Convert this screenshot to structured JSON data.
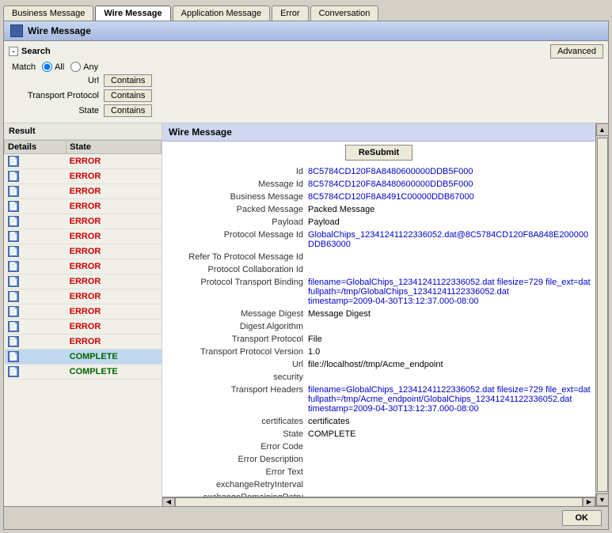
{
  "tabs": [
    {
      "id": "business-message",
      "label": "Business Message",
      "active": false
    },
    {
      "id": "wire-message",
      "label": "Wire Message",
      "active": true
    },
    {
      "id": "application-message",
      "label": "Application Message",
      "active": false
    },
    {
      "id": "error",
      "label": "Error",
      "active": false
    },
    {
      "id": "conversation",
      "label": "Conversation",
      "active": false
    }
  ],
  "title": "Wire Message",
  "search": {
    "header": "Search",
    "match_label": "Match",
    "match_all": "All",
    "match_any": "Any",
    "url_label": "Url",
    "url_value": "Contains",
    "transport_protocol_label": "Transport Protocol",
    "transport_protocol_value": "Contains",
    "state_label": "State",
    "state_value": "Contains",
    "advanced_label": "Advanced"
  },
  "result": {
    "title": "Result",
    "columns": [
      "Details",
      "State"
    ],
    "rows": [
      {
        "state": "ERROR",
        "selected": false
      },
      {
        "state": "ERROR",
        "selected": false
      },
      {
        "state": "ERROR",
        "selected": false
      },
      {
        "state": "ERROR",
        "selected": false
      },
      {
        "state": "ERROR",
        "selected": false
      },
      {
        "state": "ERROR",
        "selected": false
      },
      {
        "state": "ERROR",
        "selected": false
      },
      {
        "state": "ERROR",
        "selected": false
      },
      {
        "state": "ERROR",
        "selected": false
      },
      {
        "state": "ERROR",
        "selected": false
      },
      {
        "state": "ERROR",
        "selected": false
      },
      {
        "state": "ERROR",
        "selected": false
      },
      {
        "state": "ERROR",
        "selected": false
      },
      {
        "state": "COMPLETE",
        "selected": true
      },
      {
        "state": "COMPLETE",
        "selected": false
      }
    ]
  },
  "wire_message": {
    "title": "Wire Message",
    "resubmit_label": "ReSubmit",
    "fields": [
      {
        "label": "Id",
        "value": "8C5784CD120F8A8480600000DDB5F000",
        "link": true
      },
      {
        "label": "Message Id",
        "value": "8C5784CD120F8A8480600000DDB5F000",
        "link": true
      },
      {
        "label": "Business Message",
        "value": "8C5784CD120F8A8491C00000DDB67000",
        "link": true
      },
      {
        "label": "Packed Message",
        "value": "Packed Message",
        "link": false
      },
      {
        "label": "Payload",
        "value": "Payload",
        "link": false
      },
      {
        "label": "Protocol Message Id",
        "value": "GlobalChips_12341241122336052.dat@8C5784CD120F8A848E200000DDB63000",
        "link": true
      },
      {
        "label": "Refer To Protocol Message Id",
        "value": "",
        "link": false
      },
      {
        "label": "Protocol Collaboration Id",
        "value": "",
        "link": false
      },
      {
        "label": "Protocol Transport Binding",
        "value": "filename=GlobalChips_12341241122336052.dat filesize=729 file_ext=dat\nfullpath=/tmp/GlobalChips_12341241122336052.dat\ntimestamp=2009-04-30T13:12:37.000-08:00",
        "link": true
      },
      {
        "label": "Message Digest",
        "value": "Message Digest",
        "link": false
      },
      {
        "label": "Digest Algorithm",
        "value": "",
        "link": false
      },
      {
        "label": "Transport Protocol",
        "value": "File",
        "link": false
      },
      {
        "label": "Transport Protocol Version",
        "value": "1.0",
        "link": false
      },
      {
        "label": "Url",
        "value": "file://localhost//tmp/Acme_endpoint",
        "link": false
      },
      {
        "label": "security",
        "value": "",
        "link": false
      },
      {
        "label": "Transport Headers",
        "value": "filename=GlobalChips_12341241122336052.dat filesize=729 file_ext=dat\nfullpath=/tmp/Acme_endpoint/GlobalChips_12341241122336052.dat\ntimestamp=2009-04-30T13:12:37.000-08:00",
        "link": true
      },
      {
        "label": "certificates",
        "value": "certificates",
        "link": false
      },
      {
        "label": "State",
        "value": "COMPLETE",
        "link": false
      },
      {
        "label": "Error Code",
        "value": "",
        "link": false
      },
      {
        "label": "Error Description",
        "value": "",
        "link": false
      },
      {
        "label": "Error Text",
        "value": "",
        "link": false
      },
      {
        "label": "exchangeRetryInterval",
        "value": "",
        "link": false
      },
      {
        "label": "exchangeRemainingRetry",
        "value": "",
        "link": false
      }
    ]
  },
  "ok_label": "OK"
}
